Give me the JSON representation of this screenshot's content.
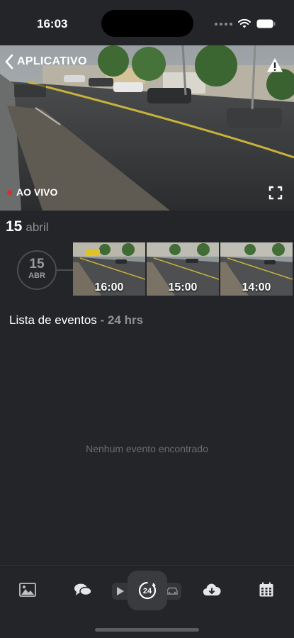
{
  "status_bar": {
    "time": "16:03"
  },
  "camera": {
    "back_label": "APLICATIVO",
    "live_label": "AO VIVO"
  },
  "date": {
    "day": "15",
    "month": "abril",
    "badge_day": "15",
    "badge_month": "ABR"
  },
  "timeline": {
    "thumbnails": [
      {
        "time": "16:00"
      },
      {
        "time": "15:00"
      },
      {
        "time": "14:00"
      }
    ]
  },
  "events": {
    "title": "Lista de eventos",
    "period": "- 24 hrs",
    "empty_message": "Nenhum evento encontrado"
  },
  "tab_bar": {
    "center_label": "24",
    "icons": [
      "image-icon",
      "chat-icon",
      "play-icon",
      "history-24-icon",
      "car-icon",
      "cloud-download-icon",
      "calendar-icon"
    ]
  },
  "colors": {
    "background": "#242528",
    "live": "#e1282d",
    "muted": "#8f9094"
  }
}
